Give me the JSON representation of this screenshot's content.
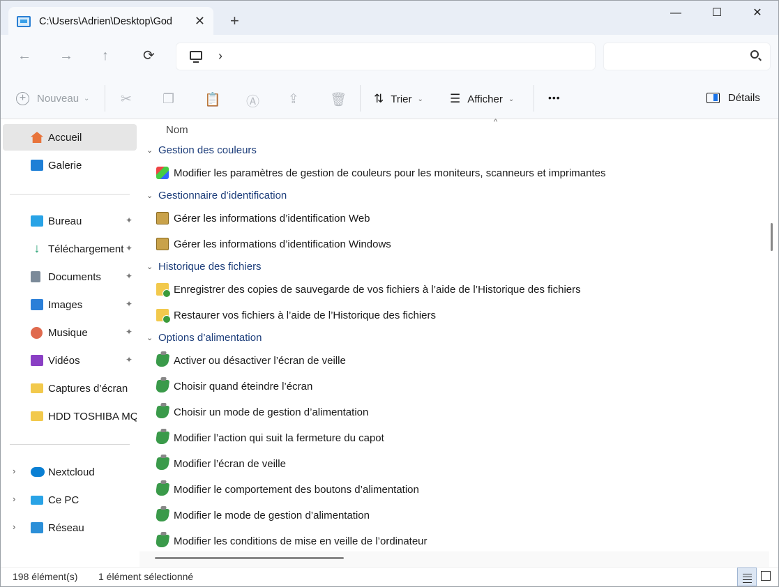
{
  "window": {
    "tab_title": "C:\\Users\\Adrien\\Desktop\\God",
    "tab_close": "✕",
    "new_tab": "+",
    "minimize": "—",
    "maximize": "☐",
    "close": "✕"
  },
  "nav": {
    "back": "←",
    "forward": "→",
    "up": "↑",
    "refresh": "⟳",
    "breadcrumb_chevron": "›",
    "search_placeholder": ""
  },
  "toolbar": {
    "new_label": "Nouveau",
    "sort_label": "Trier",
    "view_label": "Afficher",
    "more": "•••",
    "details_label": "Détails"
  },
  "sidebar": {
    "items": [
      {
        "label": "Accueil",
        "icon": "home-icon",
        "color": "#e8743b"
      },
      {
        "label": "Galerie",
        "icon": "gallery-icon",
        "color": "#1e7fd6"
      },
      {
        "label": "Bureau",
        "icon": "desktop-folder-icon",
        "color": "#29a3e6"
      },
      {
        "label": "Téléchargement",
        "icon": "download-icon",
        "color": "#1a9c6b"
      },
      {
        "label": "Documents",
        "icon": "documents-icon",
        "color": "#7b8a99"
      },
      {
        "label": "Images",
        "icon": "pictures-icon",
        "color": "#2b7fd8"
      },
      {
        "label": "Musique",
        "icon": "music-icon",
        "color": "#e06a4e"
      },
      {
        "label": "Vidéos",
        "icon": "videos-icon",
        "color": "#8a3fc4"
      },
      {
        "label": "Captures d’écran",
        "icon": "folder-icon",
        "color": "#f2c94c"
      },
      {
        "label": "HDD TOSHIBA MQ",
        "icon": "folder-icon",
        "color": "#f2c94c"
      },
      {
        "label": "Nextcloud",
        "icon": "nextcloud-icon",
        "color": "#0a7fd3"
      },
      {
        "label": "Ce PC",
        "icon": "this-pc-icon",
        "color": "#29a3e6"
      },
      {
        "label": "Réseau",
        "icon": "network-icon",
        "color": "#2b8fd8"
      }
    ],
    "pin": "📌",
    "expand": "›"
  },
  "main": {
    "column_header": "Nom",
    "sort_chevron": "^",
    "groups": [
      {
        "title": "Gestion des couleurs",
        "icon": "color-management-icon",
        "items": [
          "Modifier les paramètres de gestion de couleurs pour les moniteurs, scanneurs et imprimantes"
        ]
      },
      {
        "title": "Gestionnaire d’identification",
        "icon": "credential-manager-icon",
        "items": [
          "Gérer les informations d’identification Web",
          "Gérer les informations d’identification Windows"
        ]
      },
      {
        "title": "Historique des fichiers",
        "icon": "file-history-icon",
        "items": [
          "Enregistrer des copies de sauvegarde de vos fichiers à l’aide de l’Historique des fichiers",
          "Restaurer vos fichiers à l’aide de l’Historique des fichiers"
        ]
      },
      {
        "title": "Options d’alimentation",
        "icon": "power-options-icon",
        "items": [
          "Activer ou désactiver l’écran de veille",
          "Choisir quand éteindre l’écran",
          "Choisir un mode de gestion d’alimentation",
          "Modifier l’action qui suit la fermeture du capot",
          "Modifier l’écran de veille",
          "Modifier le comportement des boutons d’alimentation",
          "Modifier le mode de gestion d’alimentation",
          "Modifier les conditions de mise en veille de l’ordinateur"
        ]
      }
    ]
  },
  "status": {
    "count": "198 élément(s)",
    "selected": "1 élément sélectionné"
  }
}
